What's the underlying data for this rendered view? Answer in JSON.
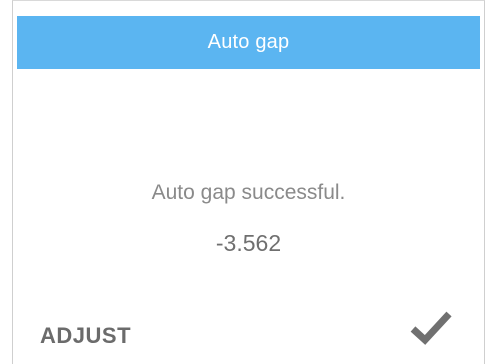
{
  "dialog": {
    "title": "Auto gap",
    "message": "Auto gap successful.",
    "value": "-3.562",
    "adjust_label": "ADJUST",
    "confirm_icon": "checkmark-icon"
  },
  "colors": {
    "title_bar": "#5bb5f1",
    "title_text": "#ffffff",
    "message_text": "#8a8a8a",
    "value_text": "#6f6f6f",
    "adjust_text": "#6b6b6b",
    "checkmark": "#707070"
  }
}
